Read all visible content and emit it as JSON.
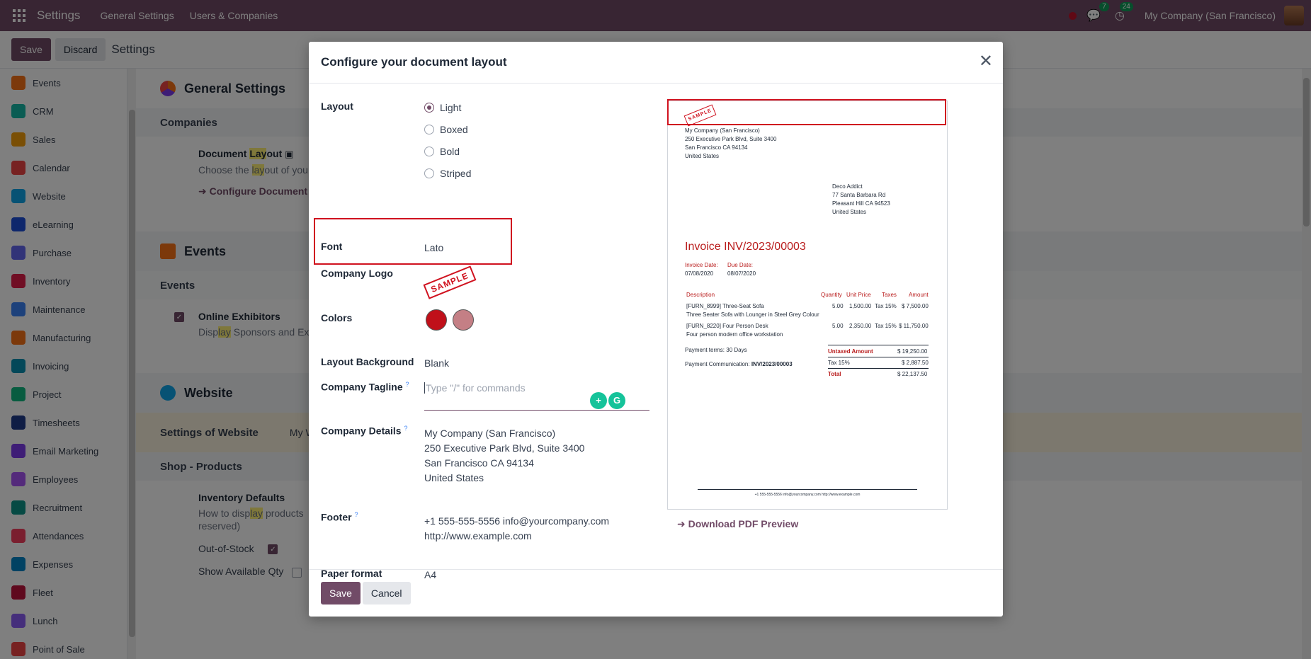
{
  "navbar": {
    "brand": "Settings",
    "menu": [
      "General Settings",
      "Users & Companies"
    ],
    "chat_count": "7",
    "activity_count": "24",
    "company": "My Company (San Francisco)"
  },
  "control": {
    "save_label": "Save",
    "discard_label": "Discard",
    "title": "Settings"
  },
  "sidebar": {
    "items": [
      {
        "label": "Events",
        "color": "#f97316"
      },
      {
        "label": "CRM",
        "color": "#14b8a6"
      },
      {
        "label": "Sales",
        "color": "#f59e0b"
      },
      {
        "label": "Calendar",
        "color": "#ef4444"
      },
      {
        "label": "Website",
        "color": "#0ea5e9"
      },
      {
        "label": "eLearning",
        "color": "#1d4ed8"
      },
      {
        "label": "Purchase",
        "color": "#6366f1"
      },
      {
        "label": "Inventory",
        "color": "#e11d48"
      },
      {
        "label": "Maintenance",
        "color": "#3b82f6"
      },
      {
        "label": "Manufacturing",
        "color": "#f97316"
      },
      {
        "label": "Invoicing",
        "color": "#0891b2"
      },
      {
        "label": "Project",
        "color": "#10b981"
      },
      {
        "label": "Timesheets",
        "color": "#1e3a8a"
      },
      {
        "label": "Email Marketing",
        "color": "#7c3aed"
      },
      {
        "label": "Employees",
        "color": "#a855f7"
      },
      {
        "label": "Recruitment",
        "color": "#0d9488"
      },
      {
        "label": "Attendances",
        "color": "#f43f5e"
      },
      {
        "label": "Expenses",
        "color": "#0284c7"
      },
      {
        "label": "Fleet",
        "color": "#be123c"
      },
      {
        "label": "Lunch",
        "color": "#8b5cf6"
      },
      {
        "label": "Point of Sale",
        "color": "#ef4444"
      }
    ]
  },
  "background": {
    "general_settings_title": "General Settings",
    "companies_heading": "Companies",
    "doc_layout_title_pre": "Document ",
    "doc_layout_title_hl": "Lay",
    "doc_layout_title_post": "out",
    "doc_layout_desc_pre": "Choose the ",
    "doc_layout_desc_hl": "lay",
    "doc_layout_desc_post": "out of you",
    "configure_link": "Configure Document",
    "events_title": "Events",
    "events_heading": "Events",
    "online_exhibitors": "Online Exhibitors",
    "exhibitors_desc_pre": "Disp",
    "exhibitors_desc_hl": "lay",
    "exhibitors_desc_post": " Sponsors and Exh",
    "website_title": "Website",
    "settings_of_website": "Settings of Website",
    "website_select": "My W",
    "shop_heading": "Shop - Products",
    "inventory_defaults": "Inventory Defaults",
    "inventory_desc_pre": "How to disp",
    "inventory_desc_hl": "lay",
    "inventory_desc_post": " products",
    "inventory_desc_2": "reserved)",
    "out_of_stock": "Out-of-Stock",
    "show_available_qty": "Show Available Qty"
  },
  "modal": {
    "title": "Configure your document layout",
    "layout_label": "Layout",
    "layout_options": [
      "Light",
      "Boxed",
      "Bold",
      "Striped"
    ],
    "layout_selected": "Light",
    "font_label": "Font",
    "font_value": "Lato",
    "logo_label": "Company Logo",
    "logo_stamp": "SAMPLE",
    "colors_label": "Colors",
    "primary_color": "#c0101a",
    "secondary_color": "#c47f85",
    "layout_bg_label": "Layout Background",
    "layout_bg_value": "Blank",
    "tagline_label": "Company Tagline",
    "tagline_help": "?",
    "tagline_placeholder": "Type \"/\" for commands",
    "details_label": "Company Details",
    "details_help": "?",
    "details_lines": [
      "My Company (San Francisco)",
      "250 Executive Park Blvd, Suite 3400",
      "San Francisco CA 94134",
      "United States"
    ],
    "footer_label": "Footer",
    "footer_help": "?",
    "footer_lines": [
      "+1 555-555-5556 info@yourcompany.com",
      "http://www.example.com"
    ],
    "paper_label": "Paper format",
    "paper_value": "A4",
    "save_label": "Save",
    "cancel_label": "Cancel",
    "download_link": "Download PDF Preview"
  },
  "preview": {
    "stamp": "SAMPLE",
    "company_lines": [
      "My Company (San Francisco)",
      "250 Executive Park Blvd, Suite 3400",
      "San Francisco CA 94134",
      "United States"
    ],
    "customer_lines": [
      "Deco Addict",
      "77 Santa Barbara Rd",
      "Pleasant Hill CA 94523",
      "United States"
    ],
    "invoice_title": "Invoice INV/2023/00003",
    "invoice_date_label": "Invoice Date:",
    "invoice_date": "07/08/2020",
    "due_date_label": "Due Date:",
    "due_date": "08/07/2020",
    "table_headers": [
      "Description",
      "Quantity",
      "Unit Price",
      "Taxes",
      "Amount"
    ],
    "lines": [
      {
        "desc": "[FURN_8999] Three-Seat Sofa",
        "desc2": "Three Seater Sofa with Lounger in Steel Grey Colour",
        "qty": "5.00",
        "price": "1,500.00",
        "tax": "Tax 15%",
        "amount": "$ 7,500.00"
      },
      {
        "desc": "[FURN_8220] Four Person Desk",
        "desc2": "Four person modern office workstation",
        "qty": "5.00",
        "price": "2,350.00",
        "tax": "Tax 15%",
        "amount": "$ 11,750.00"
      }
    ],
    "payment_terms": "Payment terms: 30 Days",
    "payment_comm_label": "Payment Communication:",
    "payment_comm_value": "INV/2023/00003",
    "untaxed_label": "Untaxed Amount",
    "untaxed_value": "$ 19,250.00",
    "tax_label": "Tax 15%",
    "tax_value": "$ 2,887.50",
    "total_label": "Total",
    "total_value": "$ 22,137.50",
    "footer_text": "+1 555-555-5556 info@yourcompany.com http://www.example.com"
  }
}
